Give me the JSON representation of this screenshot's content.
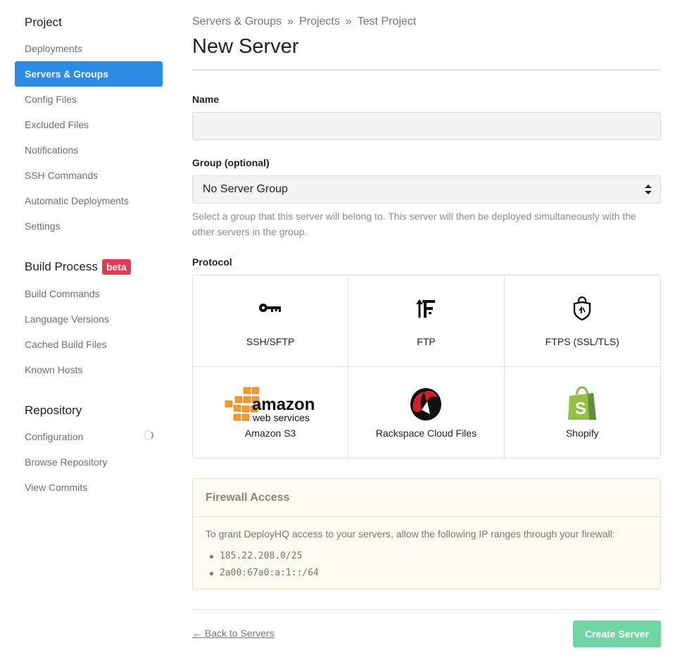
{
  "sidebar": {
    "project": {
      "title": "Project",
      "items": [
        "Deployments",
        "Servers & Groups",
        "Config Files",
        "Excluded Files",
        "Notifications",
        "SSH Commands",
        "Automatic Deployments",
        "Settings"
      ]
    },
    "build": {
      "title": "Build Process",
      "badge": "beta",
      "items": [
        "Build Commands",
        "Language Versions",
        "Cached Build Files",
        "Known Hosts"
      ]
    },
    "repository": {
      "title": "Repository",
      "items": [
        "Configuration",
        "Browse Repository",
        "View Commits"
      ]
    }
  },
  "breadcrumb": [
    "Servers & Groups",
    "Projects",
    "Test Project"
  ],
  "breadcrumb_separator": "»",
  "page_title": "New Server",
  "form": {
    "name_label": "Name",
    "name_value": "",
    "group_label": "Group (optional)",
    "group_selected": "No Server Group",
    "group_help": "Select a group that this server will belong to. This server will then be deployed simultaneously with the other servers in the group.",
    "protocol_label": "Protocol",
    "protocols": [
      "SSH/SFTP",
      "FTP",
      "FTPS (SSL/TLS)",
      "Amazon S3",
      "Rackspace Cloud Files",
      "Shopify"
    ],
    "amazon_logo_text": "amazon",
    "amazon_logo_sub": "web services"
  },
  "firewall": {
    "title": "Firewall Access",
    "text": "To grant DeployHQ access to your servers, allow the following IP ranges through your firewall:",
    "ranges": [
      "185.22.208.0/25",
      "2a00:67a0:a:1::/64"
    ]
  },
  "actions": {
    "back": "← Back to Servers",
    "create": "Create Server"
  },
  "colors": {
    "active_nav": "#2b8ce6",
    "badge": "#e03b50",
    "create_button": "#6fd6a3",
    "firewall_bg": "#fdfbf1"
  }
}
